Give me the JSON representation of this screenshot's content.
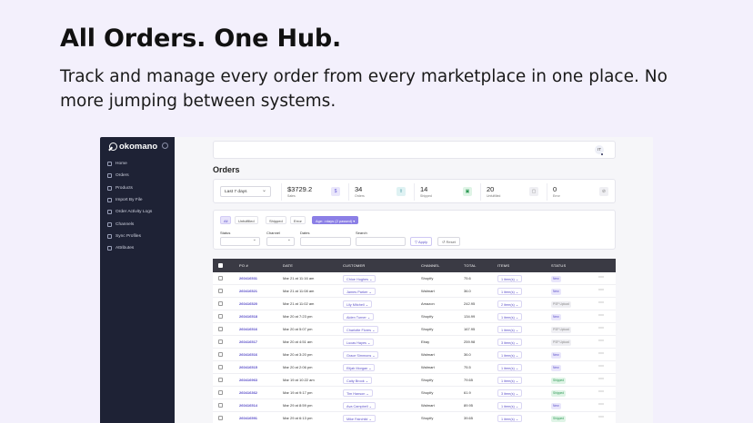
{
  "hero": {
    "title": "All Orders. One Hub.",
    "subtitle": "Track and manage every order from every marketplace in one place. No more jumping between systems."
  },
  "app": {
    "logo": "okomano",
    "nav": [
      {
        "label": "Home",
        "icon": "home-icon"
      },
      {
        "label": "Orders",
        "icon": "cart-icon"
      },
      {
        "label": "Products",
        "icon": "box-icon"
      },
      {
        "label": "Import By File",
        "icon": "file-icon"
      },
      {
        "label": "Order Activity Logs",
        "icon": "log-icon"
      },
      {
        "label": "Channels",
        "icon": "channels-icon"
      },
      {
        "label": "Sync Profiles",
        "icon": "sync-icon"
      },
      {
        "label": "Attributes",
        "icon": "tag-icon"
      }
    ],
    "avatar": "IT",
    "page_title": "Orders",
    "range": "Last 7 days",
    "stats": [
      {
        "value": "$3729.2",
        "label": "Sales",
        "bg": "#e9e6fb",
        "fg": "#6b5fd9",
        "glyph": "$"
      },
      {
        "value": "34",
        "label": "Orders",
        "bg": "#dff2f3",
        "fg": "#2f8d96",
        "glyph": "⇧"
      },
      {
        "value": "14",
        "label": "Shipped",
        "bg": "#dff4e6",
        "fg": "#2f9a55",
        "glyph": "▣"
      },
      {
        "value": "20",
        "label": "Unfulfilled",
        "bg": "#efeff3",
        "fg": "#888",
        "glyph": "▢"
      },
      {
        "value": "0",
        "label": "Error",
        "bg": "#efeff3",
        "fg": "#888",
        "glyph": "⊘"
      }
    ],
    "filter_tabs": [
      "All",
      "Unfulfilled",
      "Shipped",
      "Error"
    ],
    "filter_pill": "Age: >days (2 passed) ▾",
    "filter_labels": {
      "status": "Status",
      "channel": "Channel",
      "dates": "Dates",
      "search": "Search"
    },
    "apply_label": "▽ Apply",
    "reset_label": "↺ Reset",
    "columns": [
      "PO #",
      "DATE",
      "CUSTOMER",
      "CHANNEL",
      "TOTAL",
      "ITEMS",
      "STATUS"
    ],
    "rows": [
      {
        "po": "260416531",
        "date": "Mar 21 at 11:16 am",
        "customer": "Chloe Hughes",
        "channel": "Shopify",
        "total": "75.6",
        "items": "1 item(s)",
        "status": "New"
      },
      {
        "po": "260416521",
        "date": "Mar 21 at 11:08 am",
        "customer": "James Parker",
        "channel": "Walmart",
        "total": "36.0",
        "items": "1 item(s)",
        "status": "New"
      },
      {
        "po": "260416520",
        "date": "Mar 21 at 11:02 am",
        "customer": "Lily Mitchell",
        "channel": "Amazon",
        "total": "242.95",
        "items": "2 item(s)",
        "status": "PSP Upload"
      },
      {
        "po": "260416518",
        "date": "Mar 20 at 7:23 pm",
        "customer": "Aiden Turner",
        "channel": "Shopify",
        "total": "134.99",
        "items": "1 item(s)",
        "status": "New"
      },
      {
        "po": "260416516",
        "date": "Mar 20 at 5:07 pm",
        "customer": "Charlotte Flores",
        "channel": "Shopify",
        "total": "167.95",
        "items": "1 item(s)",
        "status": "PSP Upload"
      },
      {
        "po": "260416517",
        "date": "Mar 20 at 4:51 am",
        "customer": "Lucas Hayes",
        "channel": "Ebay",
        "total": "259.98",
        "items": "3 item(s)",
        "status": "PSP Upload"
      },
      {
        "po": "260416516",
        "date": "Mar 20 at 3:20 pm",
        "customer": "Grace Simmons",
        "channel": "Walmart",
        "total": "36.0",
        "items": "1 item(s)",
        "status": "New"
      },
      {
        "po": "260416515",
        "date": "Mar 20 at 2:06 pm",
        "customer": "Elijah Morgan",
        "channel": "Walmart",
        "total": "75.5",
        "items": "1 item(s)",
        "status": "New"
      },
      {
        "po": "260416963",
        "date": "Mar 19 at 10:22 am",
        "customer": "Caity Brook",
        "channel": "Shopify",
        "total": "79.65",
        "items": "1 item(s)",
        "status": "Shipped"
      },
      {
        "po": "260416362",
        "date": "Mar 19 at 9:17 pm",
        "customer": "Tim Hanson",
        "channel": "Shopify",
        "total": "61.9",
        "items": "3 item(s)",
        "status": "Shipped"
      },
      {
        "po": "260416514",
        "date": "Mar 29 at 8:59 pm",
        "customer": "Ava Campbell",
        "channel": "Walmart",
        "total": "89.95",
        "items": "1 item(s)",
        "status": "New"
      },
      {
        "po": "260416591",
        "date": "Mar 29 at 6:13 pm",
        "customer": "Mike Fairchild",
        "channel": "Shopify",
        "total": "39.65",
        "items": "1 item(s)",
        "status": "Shipped"
      }
    ],
    "status_colors": {
      "New": {
        "bg": "#e9e6fb",
        "fg": "#5b4fc9"
      },
      "PSP Upload": {
        "bg": "#efeff3",
        "fg": "#888"
      },
      "Shipped": {
        "bg": "#dff4e6",
        "fg": "#2f9a55"
      }
    }
  }
}
